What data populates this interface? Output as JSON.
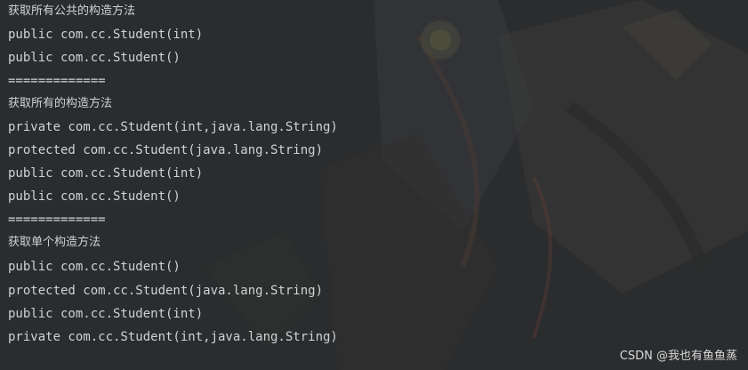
{
  "console": {
    "lines": [
      "获取所有公共的构造方法",
      "public com.cc.Student(int)",
      "public com.cc.Student()",
      "=============",
      "获取所有的构造方法",
      "private com.cc.Student(int,java.lang.String)",
      "protected com.cc.Student(java.lang.String)",
      "public com.cc.Student(int)",
      "public com.cc.Student()",
      "=============",
      "获取单个构造方法",
      "public com.cc.Student()",
      "protected com.cc.Student(java.lang.String)",
      "public com.cc.Student(int)",
      "private com.cc.Student(int,java.lang.String)"
    ]
  },
  "watermark": {
    "text": "CSDN @我也有鱼鱼蒸"
  },
  "colors": {
    "background": "#2a2c2e",
    "text": "#d0d2d4"
  }
}
